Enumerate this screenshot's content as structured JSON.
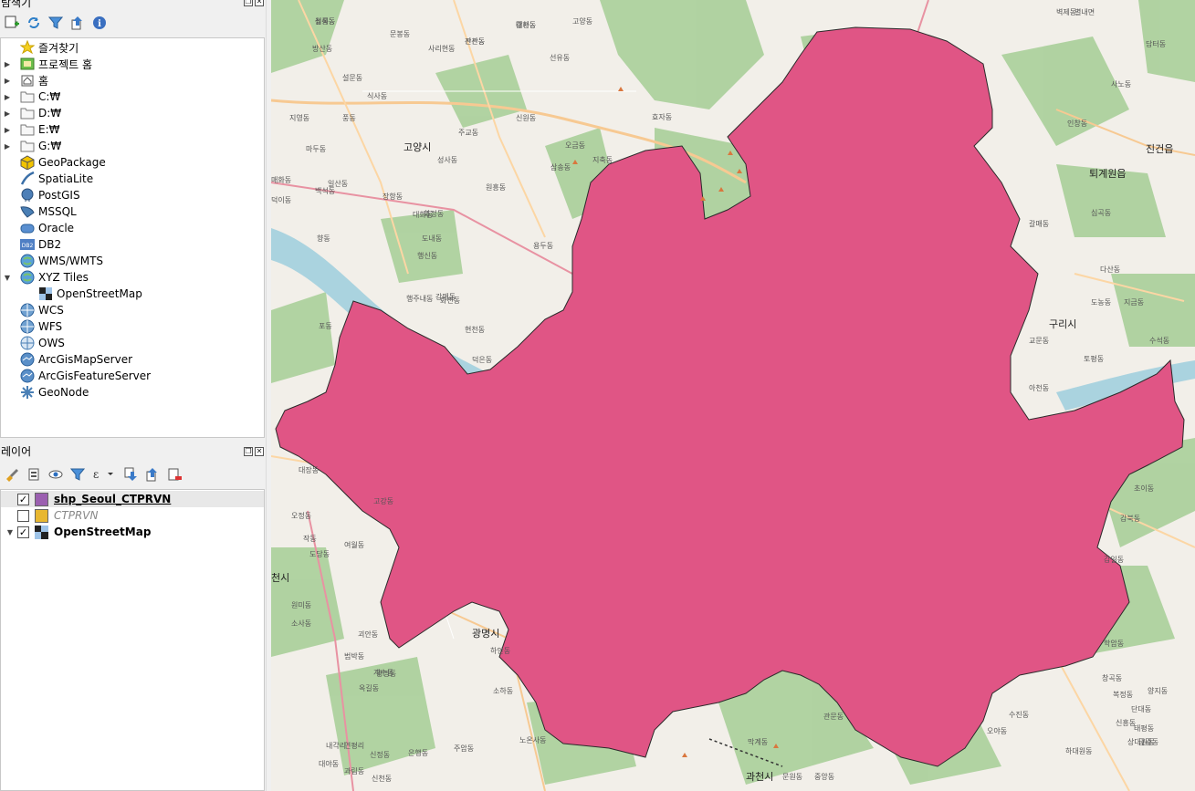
{
  "browser": {
    "title": "탐색기",
    "items": [
      {
        "label": "즐겨찾기",
        "icon": "star-icon",
        "arrow": ""
      },
      {
        "label": "프로젝트 홈",
        "icon": "project-home-icon",
        "arrow": "▶"
      },
      {
        "label": "홈",
        "icon": "home-icon",
        "arrow": "▶"
      },
      {
        "label": "C:₩",
        "icon": "folder-icon",
        "arrow": "▶"
      },
      {
        "label": "D:₩",
        "icon": "folder-icon",
        "arrow": "▶"
      },
      {
        "label": "E:₩",
        "icon": "folder-icon",
        "arrow": "▶"
      },
      {
        "label": "G:₩",
        "icon": "folder-icon",
        "arrow": "▶"
      },
      {
        "label": "GeoPackage",
        "icon": "geopackage-icon",
        "arrow": ""
      },
      {
        "label": "SpatiaLite",
        "icon": "spatialite-icon",
        "arrow": ""
      },
      {
        "label": "PostGIS",
        "icon": "postgis-icon",
        "arrow": ""
      },
      {
        "label": "MSSQL",
        "icon": "mssql-icon",
        "arrow": ""
      },
      {
        "label": "Oracle",
        "icon": "oracle-icon",
        "arrow": ""
      },
      {
        "label": "DB2",
        "icon": "db2-icon",
        "arrow": ""
      },
      {
        "label": "WMS/WMTS",
        "icon": "wms-icon",
        "arrow": ""
      },
      {
        "label": "XYZ Tiles",
        "icon": "xyz-icon",
        "arrow": "▼"
      },
      {
        "label": "OpenStreetMap",
        "icon": "osm-tile-icon",
        "arrow": "",
        "indent": true
      },
      {
        "label": "WCS",
        "icon": "wcs-icon",
        "arrow": ""
      },
      {
        "label": "WFS",
        "icon": "wfs-icon",
        "arrow": ""
      },
      {
        "label": "OWS",
        "icon": "ows-icon",
        "arrow": ""
      },
      {
        "label": "ArcGisMapServer",
        "icon": "arcgis-map-icon",
        "arrow": ""
      },
      {
        "label": "ArcGisFeatureServer",
        "icon": "arcgis-feature-icon",
        "arrow": ""
      },
      {
        "label": "GeoNode",
        "icon": "geonode-icon",
        "arrow": ""
      }
    ]
  },
  "layers": {
    "title": "레이어",
    "items": [
      {
        "label": "shp_Seoul_CTPRVN",
        "checked": true,
        "color": "#9b5fb0",
        "style": "bold-underline"
      },
      {
        "label": "CTPRVN",
        "checked": false,
        "color": "#e8b730",
        "style": "italic-grey"
      },
      {
        "label": "OpenStreetMap",
        "checked": true,
        "color": "osm",
        "style": "bold"
      }
    ]
  },
  "map": {
    "polygon_color": "#e05585",
    "cities": [
      {
        "label": "고양시"
      },
      {
        "label": "구리시"
      },
      {
        "label": "광명시"
      },
      {
        "label": "과천시"
      },
      {
        "label": "진건읍"
      },
      {
        "label": "퇴계원읍"
      },
      {
        "label": "천시"
      }
    ],
    "labels": [
      "성석동",
      "대자동",
      "관산동",
      "선유동",
      "벽제동",
      "고양동",
      "사리현동",
      "문봉동",
      "식사동",
      "설문동",
      "지영동",
      "풍동",
      "마두동",
      "백석동",
      "장항동",
      "대화동",
      "일산동",
      "덕이동",
      "향동",
      "도내동",
      "행신동",
      "화정동",
      "원흥동",
      "성사동",
      "주교동",
      "삼송동",
      "지축동",
      "오금동",
      "효자동",
      "신원동",
      "용두동",
      "화전동",
      "현천동",
      "덕은동",
      "강매동",
      "행주내동",
      "대장동",
      "오정동",
      "고강동",
      "작동",
      "여월동",
      "도당동",
      "원미동",
      "소사동",
      "괴안동",
      "범박동",
      "계수동",
      "옥길동",
      "광명동",
      "하안동",
      "소하동",
      "노온사동",
      "주암동",
      "관문동",
      "막계동",
      "중앙동",
      "문원동",
      "별내면",
      "인창동",
      "교문동",
      "수석동",
      "토평동",
      "아천동",
      "갈매동",
      "다산동",
      "도농동",
      "지금동",
      "초이동",
      "감일동",
      "감북동",
      "학암동",
      "창곡동",
      "복정동",
      "양지동",
      "단대동",
      "신흥동",
      "태평동",
      "금광동",
      "상대원동",
      "하대원동",
      "수진동",
      "오야동",
      "심곡동",
      "사노동",
      "담터동",
      "내각리",
      "연평리",
      "신정동",
      "신천동",
      "은행동",
      "과림동",
      "대야동",
      "포동",
      "매화동",
      "방산동",
      "월롱동",
      "갈현동",
      "진관동"
    ]
  }
}
